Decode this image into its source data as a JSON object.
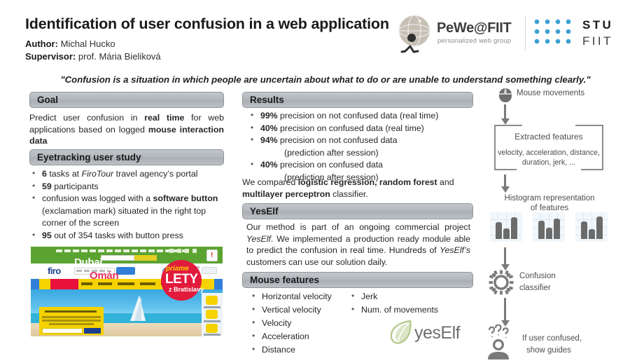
{
  "header": {
    "title": "Identification of user confusion in a web application",
    "author_label": "Author",
    "author_name": "Michal Hucko",
    "supervisor_label": "Supervisor",
    "supervisor_name": "prof. Mária Bieliková",
    "logo_pewe": "PeWe@FIIT",
    "logo_pewe_sub": "personalized web group",
    "logo_stu_1": "STU",
    "logo_stu_2": "FIIT"
  },
  "quote": "\"Confusion is a situation in which people are uncertain about what to do or are unable to understand something clearly.\"",
  "sections": {
    "goal": {
      "title": "Goal",
      "body_pre": "Predict user confusion in ",
      "body_b1": "real time",
      "body_mid": " for web applications based on logged ",
      "body_b2": "mouse interaction data"
    },
    "eyetracking": {
      "title": "Eyetracking user study",
      "items": [
        {
          "bold": "6",
          "rest": " tasks at ",
          "italic": "FiroTour",
          "tail": " travel agency’s portal"
        },
        {
          "bold": "59",
          "rest": " participants",
          "italic": "",
          "tail": ""
        },
        {
          "bold": "",
          "rest": "confusion was logged with a ",
          "italic": "",
          "tail": "",
          "bold2": "software button",
          "tail2": " (exclamation mark) situated in the right top corner of the screen"
        },
        {
          "bold": "95",
          "rest": " out of 354 tasks with button press",
          "italic": "",
          "tail": ""
        }
      ]
    },
    "results": {
      "title": "Results",
      "items": [
        {
          "pct": "99%",
          "text": " precision on not confused data (real time)",
          "sub": ""
        },
        {
          "pct": "40%",
          "text": " precision on confused data (real time)",
          "sub": ""
        },
        {
          "pct": "94%",
          "text": " precision on not confused data",
          "sub": "(prediction after session)"
        },
        {
          "pct": "40%",
          "text": " precision on confused data",
          "sub": "(prediction after session)"
        }
      ],
      "note_pre": "We compared ",
      "note_b1": "logistic regression, random forest",
      "note_mid": " and ",
      "note_b2": "multilayer perceptron",
      "note_tail": " classifier."
    },
    "yeself": {
      "title": "YesElf",
      "p1": "Our method is part of an ongoing commercial project ",
      "p_it1": "YesElf",
      "p2": ". We implemented a production ready module able to predict the confusion in real time. Hundreds of ",
      "p_it2": "YesElf’s",
      "p3": " customers can use our solution daily.",
      "logo_text": "yesElf"
    },
    "mouse_features": {
      "title": "Mouse features",
      "column_1": [
        "Horizontal velocity",
        "Vertical velocity",
        "Velocity",
        "Acceleration",
        "Distance"
      ],
      "column_2": [
        "Jerk",
        "Num. of movements"
      ]
    }
  },
  "flow": {
    "step_mouse": "Mouse movements",
    "step_features_title": "Extracted features",
    "step_features_sub": "velocity, acceleration, distance, duration, jerk, ...",
    "step_histogram_l1": "Histogram representation",
    "step_histogram_l2": "of features",
    "step_classifier_l1": "Confusion",
    "step_classifier_l2": "classifier",
    "step_guides_l1": "If user confused,",
    "step_guides_l2": "show guides"
  },
  "screenshot": {
    "site_logo": "firo",
    "hero_title_1": "Dubaj",
    "hero_title_2": "Omán",
    "badge_1": "priame",
    "badge_2": "LETY",
    "badge_3": "z Bratislavy",
    "confusion_button_glyph": "!"
  },
  "colors": {
    "section_bar": "#b2b7bc",
    "section_bar_border": "#8f969c",
    "text": "#262626",
    "flow_gray": "#7a7a7a",
    "confusion_red": "#d9251c",
    "firo_blue": "#1b3f8f",
    "firo_green": "#5ba331",
    "firo_yellow": "#f5d200",
    "yeself_green": "#b5c98a"
  }
}
